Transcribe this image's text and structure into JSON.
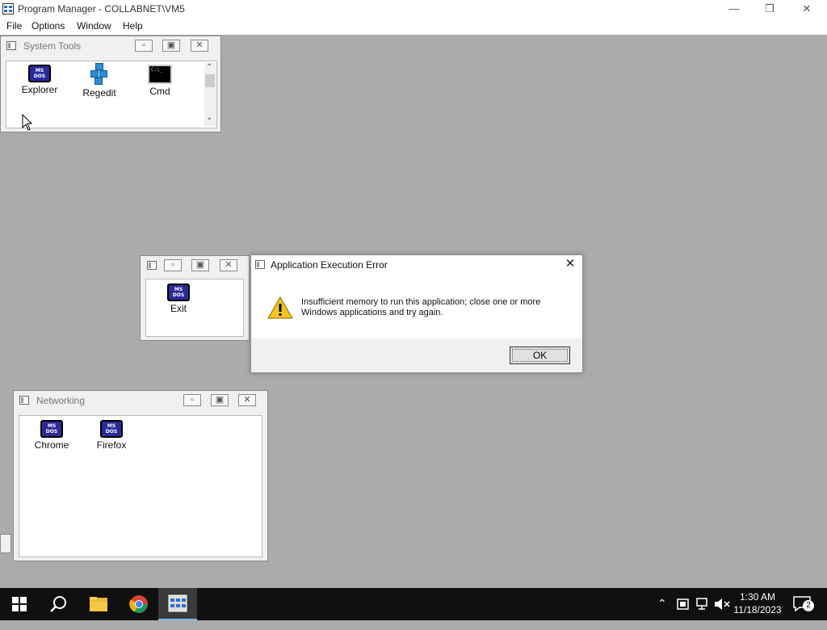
{
  "window": {
    "title": "Program Manager - COLLABNET\\VM5",
    "minimize_icon": "minimize-icon",
    "restore_icon": "restore-icon",
    "close_icon": "close-icon"
  },
  "menu": {
    "items": [
      "File",
      "Options",
      "Window",
      "Help"
    ]
  },
  "groups": {
    "system_tools": {
      "title": "System Tools",
      "items": [
        {
          "label": "Explorer",
          "icon": "msdos-icon"
        },
        {
          "label": "Regedit",
          "icon": "regedit-icon"
        },
        {
          "label": "Cmd",
          "icon": "cmd-icon"
        }
      ]
    },
    "untitled": {
      "title": "",
      "items": [
        {
          "label": "Exit",
          "icon": "msdos-icon"
        }
      ]
    },
    "networking": {
      "title": "Networking",
      "items": [
        {
          "label": "Chrome",
          "icon": "msdos-icon"
        },
        {
          "label": "Firefox",
          "icon": "msdos-icon"
        }
      ]
    }
  },
  "dialog": {
    "title": "Application Execution Error",
    "message_line1": "Insufficient memory to run this application; close one or more",
    "message_line2": "Windows applications and try again.",
    "ok_label": "OK",
    "icon": "warning-icon"
  },
  "msdos_text": {
    "line1": "MS",
    "line2": "DOS"
  },
  "taskbar": {
    "time": "1:30 AM",
    "date": "11/18/2023",
    "notification_count": "2",
    "items": [
      "start-icon",
      "search-icon",
      "file-explorer-icon",
      "chrome-icon",
      "program-manager-icon"
    ]
  },
  "colors": {
    "mdi_background": "#ababab",
    "taskbar": "#101010",
    "msdos_icon": "#2a2a9a"
  }
}
